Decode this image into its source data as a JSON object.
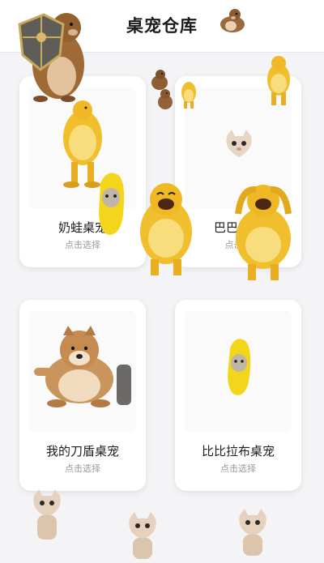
{
  "header": {
    "title": "桌宠仓库"
  },
  "cards": [
    {
      "name": "奶蛙桌宠",
      "action": "点击选择"
    },
    {
      "name": "巴巴博一",
      "action": "点击选"
    },
    {
      "name": "我的刀盾桌宠",
      "action": "点击选择"
    },
    {
      "name": "比比拉布桌宠",
      "action": "点击选择"
    }
  ],
  "colors": {
    "background": "#f4f4f6",
    "card": "#ffffff",
    "frog_yellow": "#f1bf2e",
    "banana_yellow": "#f3d51c",
    "shield_gray": "#6c6a66"
  },
  "icons": [
    "hamster-icon",
    "shield-hamster-icon",
    "yellow-frog-icon",
    "banana-cat-icon",
    "cat-face-icon",
    "doge-icon"
  ]
}
